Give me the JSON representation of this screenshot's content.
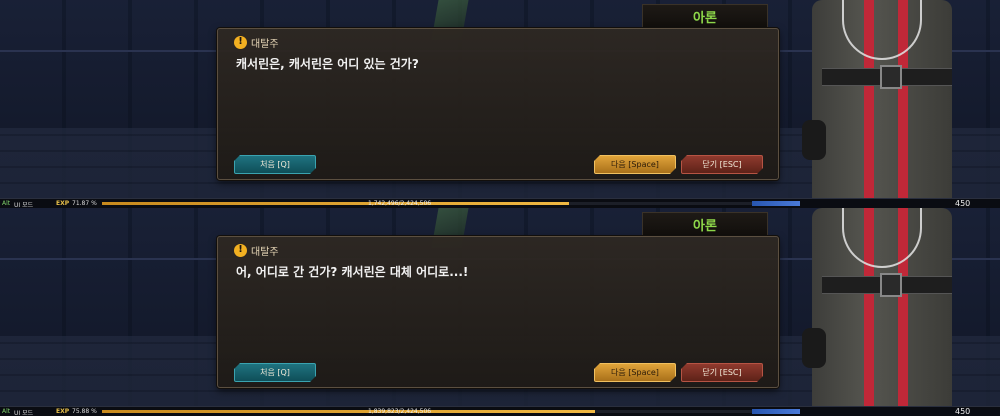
{
  "panels": [
    {
      "npc_name": "아론",
      "quest_title": "대탈주",
      "message": "캐서린은, 캐서린은 어디 있는 건가?",
      "buttons": {
        "first": "처음 [Q]",
        "next": "다음 [Space]",
        "close": "닫기 [ESC]"
      },
      "status_bar": {
        "alt": "Alt",
        "ui_mode": "UI 모드",
        "exp_label": "EXP",
        "exp_percent": "71.87 %",
        "exp_progress": 0.7187,
        "exp_amount": "1,742,496/2,424,506",
        "level": "450"
      }
    },
    {
      "npc_name": "아론",
      "quest_title": "대탈주",
      "message": "어, 어디로 간 건가? 캐서린은 대체 어디로...!",
      "buttons": {
        "first": "처음 [Q]",
        "next": "다음 [Space]",
        "close": "닫기 [ESC]"
      },
      "status_bar": {
        "alt": "Alt",
        "ui_mode": "UI 모드",
        "exp_label": "EXP",
        "exp_percent": "75.88 %",
        "exp_progress": 0.7588,
        "exp_amount": "1,839,823/2,424,506",
        "level": "450"
      }
    }
  ],
  "colors": {
    "npc_name": "#8ed84a",
    "alert_icon": "#f2b021",
    "exp_fill": "#f0b842",
    "first_button": "#1f7380",
    "next_button": "#e0a43a",
    "close_button": "#8f3a2e"
  },
  "icons": {
    "quest_alert": "exclamation-circle-icon"
  }
}
